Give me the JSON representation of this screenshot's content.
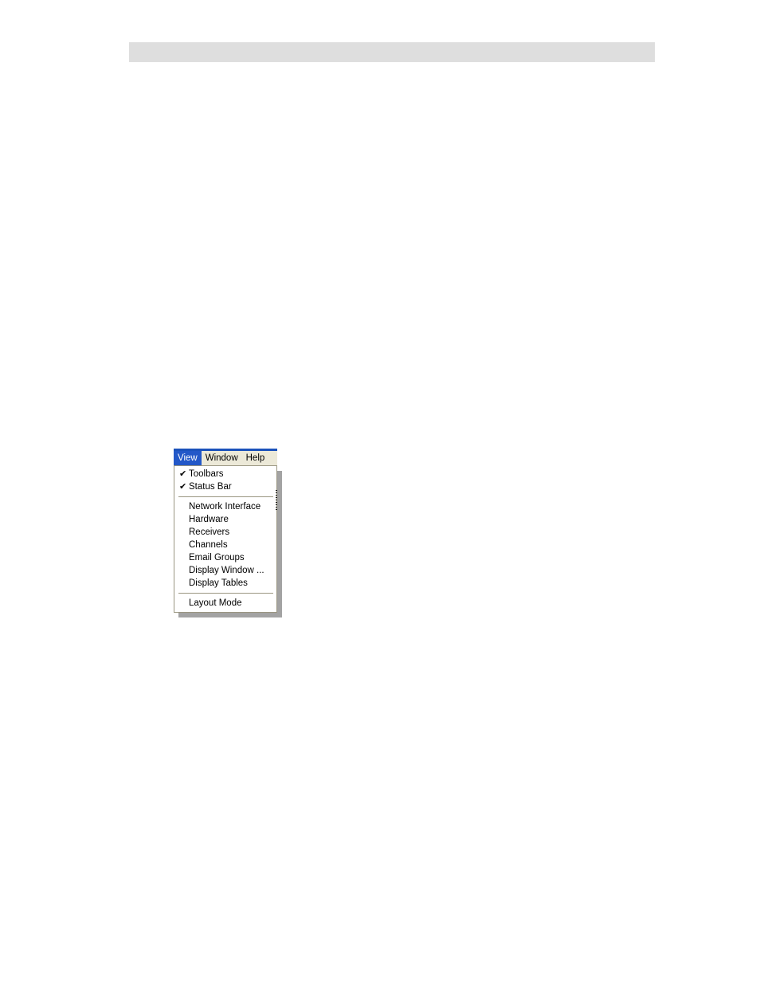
{
  "page": {
    "banner_label": ""
  },
  "menubar": {
    "items": [
      {
        "label": "View",
        "selected": true
      },
      {
        "label": "Window",
        "selected": false
      },
      {
        "label": "Help",
        "selected": false
      }
    ]
  },
  "view_menu": {
    "groups": [
      {
        "items": [
          {
            "label": "Toolbars",
            "checked": true,
            "check_glyph": "✔"
          },
          {
            "label": "Status Bar",
            "checked": true,
            "check_glyph": "✔"
          }
        ]
      },
      {
        "items": [
          {
            "label": "Network Interface",
            "checked": false
          },
          {
            "label": "Hardware",
            "checked": false
          },
          {
            "label": "Receivers",
            "checked": false
          },
          {
            "label": "Channels",
            "checked": false
          },
          {
            "label": "Email Groups",
            "checked": false
          },
          {
            "label": "Display Window ...",
            "checked": false
          },
          {
            "label": "Display Tables",
            "checked": false
          }
        ]
      },
      {
        "items": [
          {
            "label": "Layout Mode",
            "checked": false
          }
        ]
      }
    ]
  },
  "colors": {
    "menubar_background": "#ece9d8",
    "menubar_top_strip": "#1b52bb",
    "selection_background": "#2358c8",
    "selection_text": "#ffffff",
    "popup_background": "#ffffff",
    "popup_border": "#9a9681",
    "separator": "#9a9681",
    "shadow": "#808080",
    "banner_background": "#dedede",
    "page_background": "#ffffff"
  }
}
